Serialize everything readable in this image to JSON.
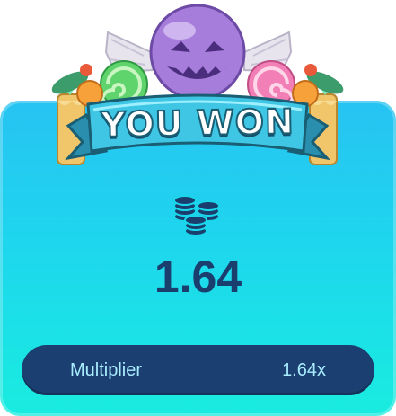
{
  "banner": {
    "title": "YOU WON"
  },
  "result": {
    "amount": "1.64",
    "icon": "coin-stack-icon"
  },
  "multiplier": {
    "label": "Multiplier",
    "value": "1.64x"
  },
  "colors": {
    "panel_top": "#27c3f2",
    "panel_bottom": "#19ecdf",
    "amount_text": "#1a3e6e",
    "bar_bg": "#1a3f70",
    "bar_text": "#a9ecff",
    "banner_fill": "#3fc6e4",
    "banner_outline": "#1a5e74"
  }
}
